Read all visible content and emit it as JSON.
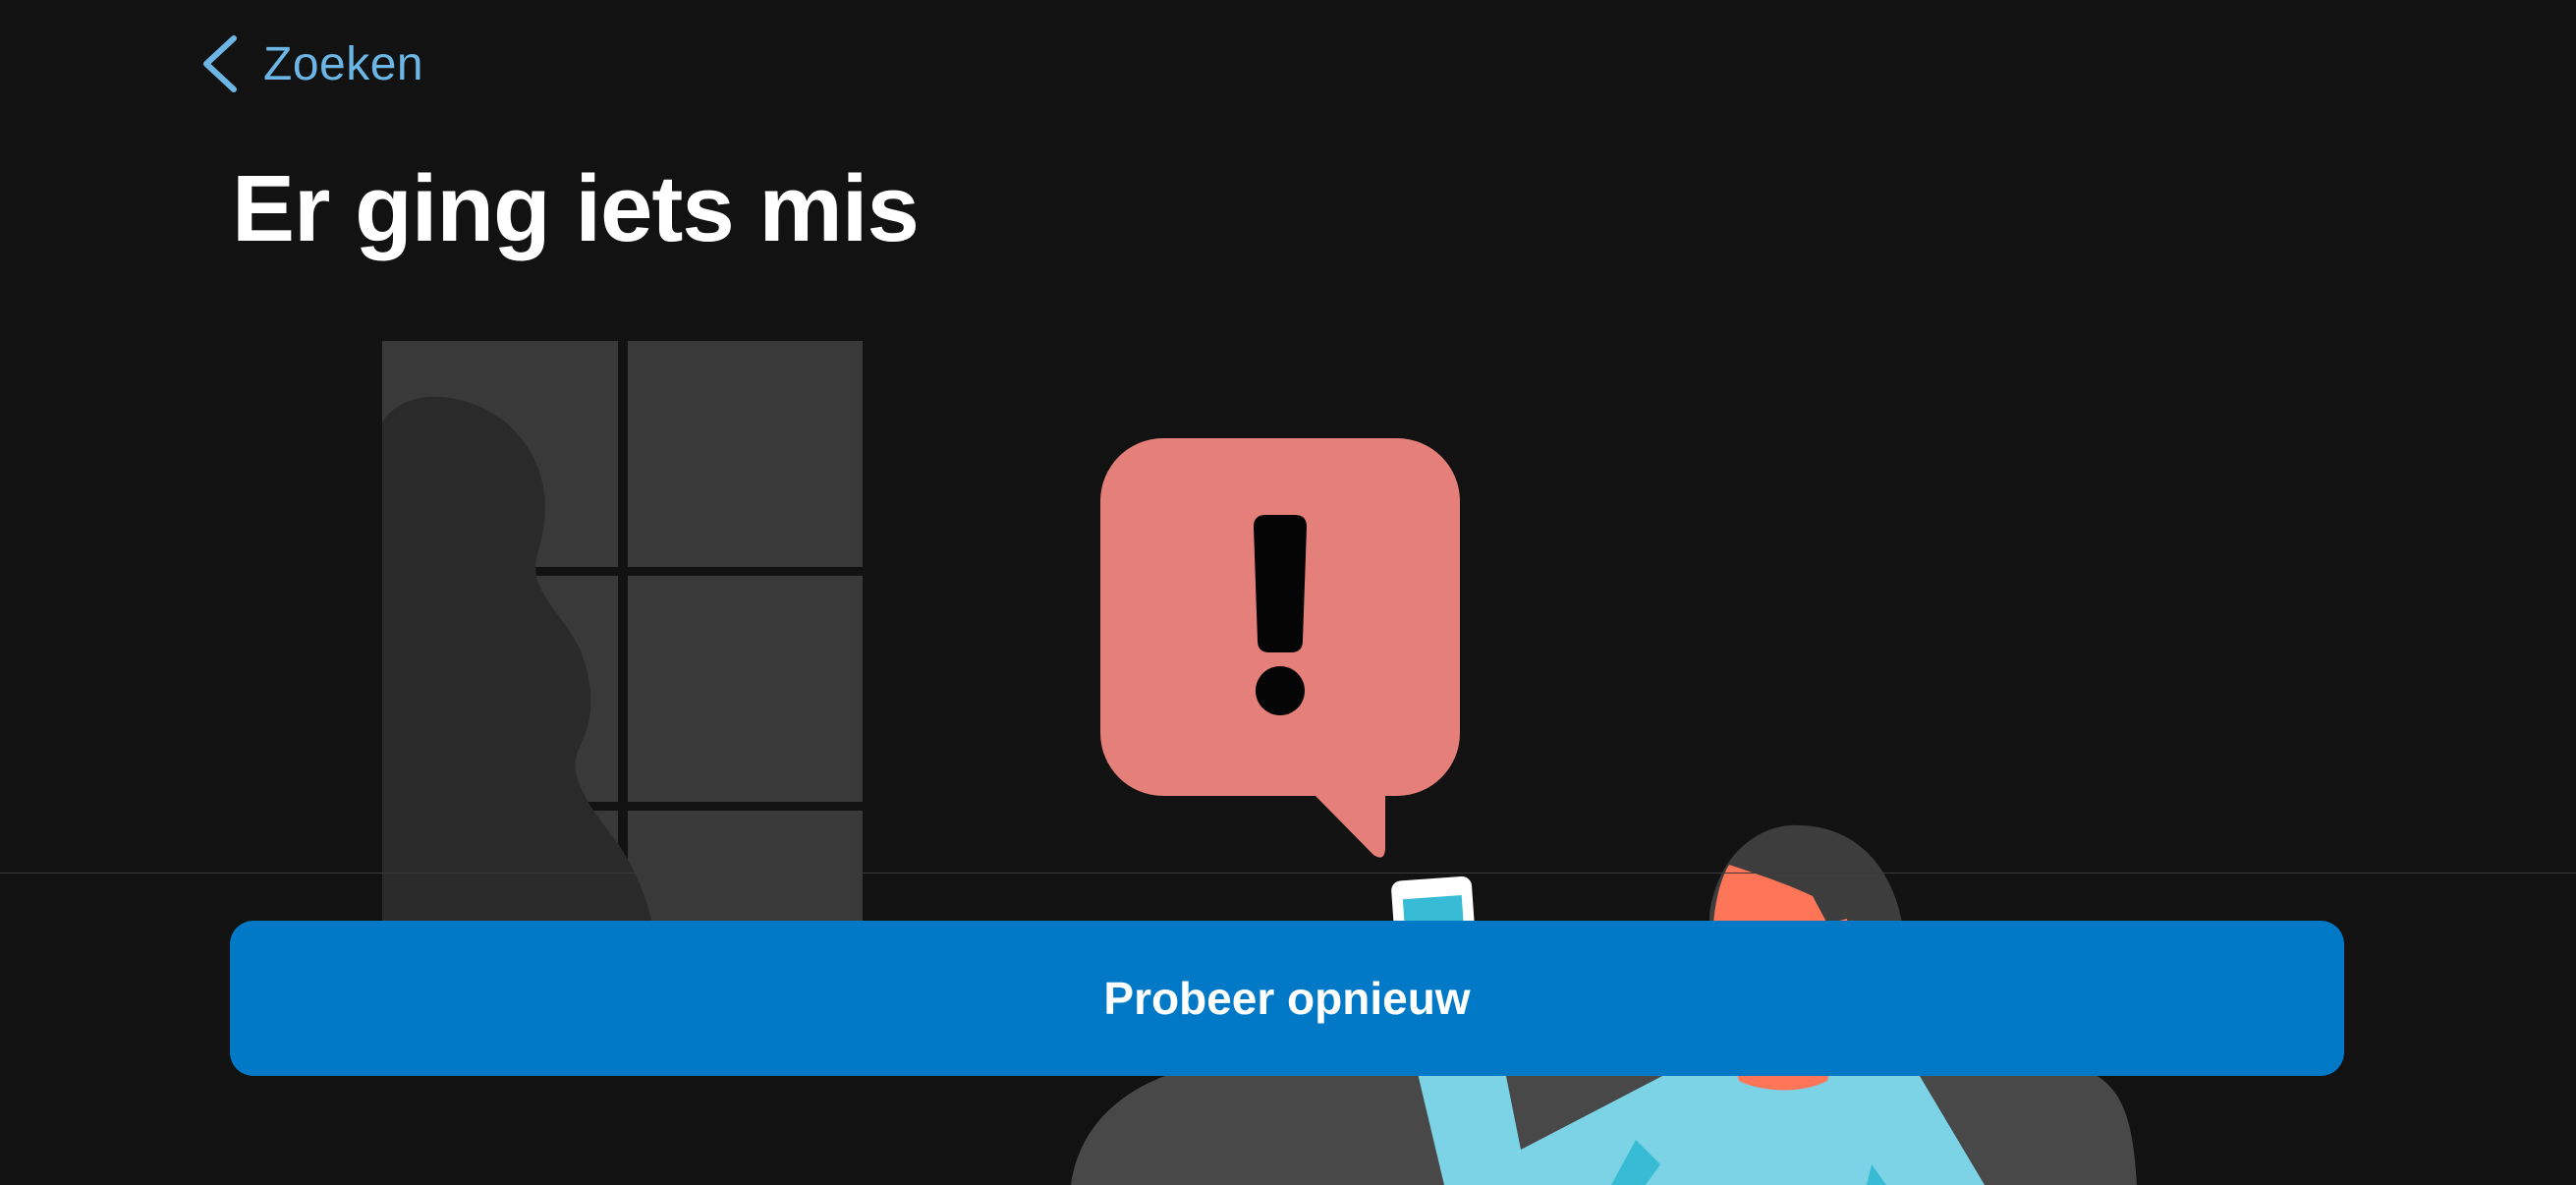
{
  "nav": {
    "back_label": "Zoeken",
    "back_icon": "chevron-left-icon"
  },
  "page": {
    "title": "Er ging iets mis"
  },
  "actions": {
    "retry_label": "Probeer opnieuw"
  },
  "illustration": {
    "alert_icon": "exclamation-icon"
  },
  "colors": {
    "background": "#121212",
    "accent_link": "#6cb6e6",
    "button": "#0279c7",
    "alert_bubble": "#e57f79",
    "person_shirt": "#7dd3e6",
    "person_skin": "#ff7558"
  }
}
